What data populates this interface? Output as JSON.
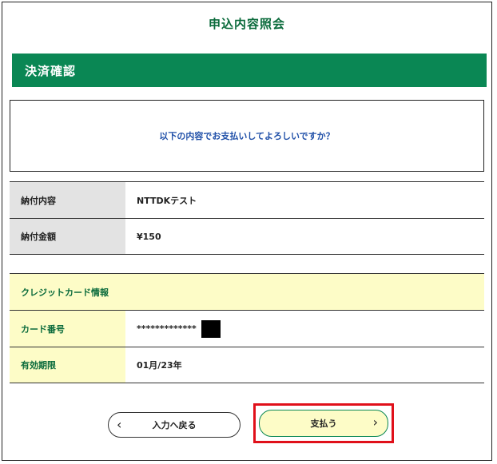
{
  "page": {
    "title": "申込内容照会",
    "section_title": "決済確認",
    "confirm_message": "以下の内容でお支払いしてよろしいですか？"
  },
  "payment_info": {
    "rows": [
      {
        "label": "納付内容",
        "value": "NTTDKテスト"
      },
      {
        "label": "納付金額",
        "value": "¥150"
      }
    ]
  },
  "card_info": {
    "header": "クレジットカード情報",
    "rows": [
      {
        "label": "カード番号",
        "value": "*************"
      },
      {
        "label": "有効期限",
        "value": "01月/23年"
      }
    ]
  },
  "buttons": {
    "back_label": "入力へ戻る",
    "pay_label": "支払う",
    "back_icon": "chevron-left-icon",
    "pay_icon": "chevron-right-icon"
  },
  "colors": {
    "title_green": "#0b6b3c",
    "bar_green": "#0a8754",
    "highlight_red": "#e0101a",
    "label_gray": "#e3e3e3",
    "card_yellow": "#fdfcc7"
  }
}
